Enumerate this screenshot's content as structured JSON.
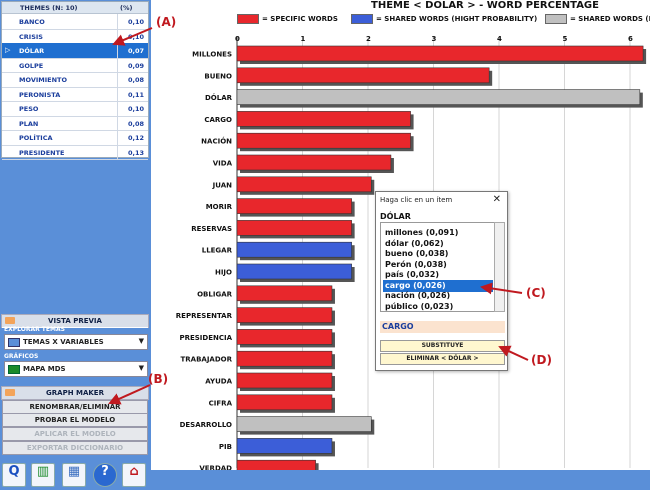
{
  "themes_table": {
    "header_name": "THEMES (N: 10)",
    "header_pct": "(%)",
    "rows": [
      {
        "name": "BANCO",
        "value": "0,10"
      },
      {
        "name": "CRISIS",
        "value": "0,10"
      },
      {
        "name": "DÓLAR",
        "value": "0,07"
      },
      {
        "name": "GOLPE",
        "value": "0,09"
      },
      {
        "name": "MOVIMIENTO",
        "value": "0,08"
      },
      {
        "name": "PERONISTA",
        "value": "0,11"
      },
      {
        "name": "PESO",
        "value": "0,10"
      },
      {
        "name": "PLAN",
        "value": "0,08"
      },
      {
        "name": "POLÍTICA",
        "value": "0,12"
      },
      {
        "name": "PRESIDENTE",
        "value": "0,13"
      }
    ],
    "selected_row": "DÓLAR"
  },
  "vista_previa": {
    "title": "VISTA PREVIA",
    "explorar_label": "EXPLORAR TEMAS",
    "explorar_value": "TEMAS X VARIABLES",
    "graficos_label": "GRÁFICOS",
    "graficos_value": "MAPA MDS"
  },
  "graph_maker": {
    "title": "GRAPH MAKER",
    "buttons": [
      "RENOMBRAR/ELIMINAR",
      "PROBAR EL MODELO",
      "APLICAR EL MODELO",
      "EXPORTAR DICCIONARIO"
    ]
  },
  "toolbar_icons": [
    "q-icon",
    "chart-icon",
    "grid-icon",
    "help-icon",
    "home-icon"
  ],
  "annotations": {
    "a": "(A)",
    "b": "(B)",
    "c": "(C)",
    "d": "(D)"
  },
  "chart_data": {
    "type": "bar",
    "title": "THEME < DÓLAR > - WORD PERCENTAGE",
    "legend": [
      {
        "label": "= SPECIFIC WORDS",
        "color": "#e8272c"
      },
      {
        "label": "= SHARED WORDS (HIGHT PROBABILITY)",
        "color": "#3c5ed8"
      },
      {
        "label": "= SHARED WORDS (L",
        "color": "#c0c0c0"
      }
    ],
    "x_ticks": [
      "0",
      "1",
      "2",
      "3",
      "4",
      "5",
      "6"
    ],
    "xlim": [
      0,
      6.2
    ],
    "categories": [
      "MILLONES",
      "BUENO",
      "DÓLAR",
      "CARGO",
      "NACIÓN",
      "VIDA",
      "JUAN",
      "MORIR",
      "RESERVAS",
      "LLEGAR",
      "HIJO",
      "OBLIGAR",
      "REPRESENTAR",
      "PRESIDENCIA",
      "TRABAJADOR",
      "AYUDA",
      "CIFRA",
      "DESARROLLO",
      "PIB",
      "VERDAD"
    ],
    "values": [
      6.2,
      3.85,
      6.15,
      2.65,
      2.65,
      2.35,
      2.05,
      1.75,
      1.75,
      1.75,
      1.75,
      1.45,
      1.45,
      1.45,
      1.45,
      1.45,
      1.45,
      2.05,
      1.45,
      1.2
    ],
    "groups": [
      "specific",
      "specific",
      "shared-low",
      "specific",
      "specific",
      "specific",
      "specific",
      "specific",
      "specific",
      "shared-high",
      "shared-high",
      "specific",
      "specific",
      "specific",
      "specific",
      "specific",
      "specific",
      "shared-low",
      "shared-high",
      "specific"
    ],
    "group_colors": {
      "specific": "#e8272c",
      "shared-high": "#3c5ed8",
      "shared-low": "#c0c0c0"
    }
  },
  "popup": {
    "title": "Haga clic en un ítem",
    "close": "✕",
    "heading": "DÓLAR",
    "items": [
      "millones (0,091)",
      "dólar (0,062)",
      "bueno (0,038)",
      "Perón (0,038)",
      "país (0,032)",
      "cargo (0,026)",
      "nación (0,026)",
      "público (0,023)"
    ],
    "selected_item": "cargo (0,026)",
    "field_value": "CARGO",
    "substituye_label": "SUBSTITUYE",
    "eliminar_label": "ELIMINAR < DÓLAR >"
  }
}
